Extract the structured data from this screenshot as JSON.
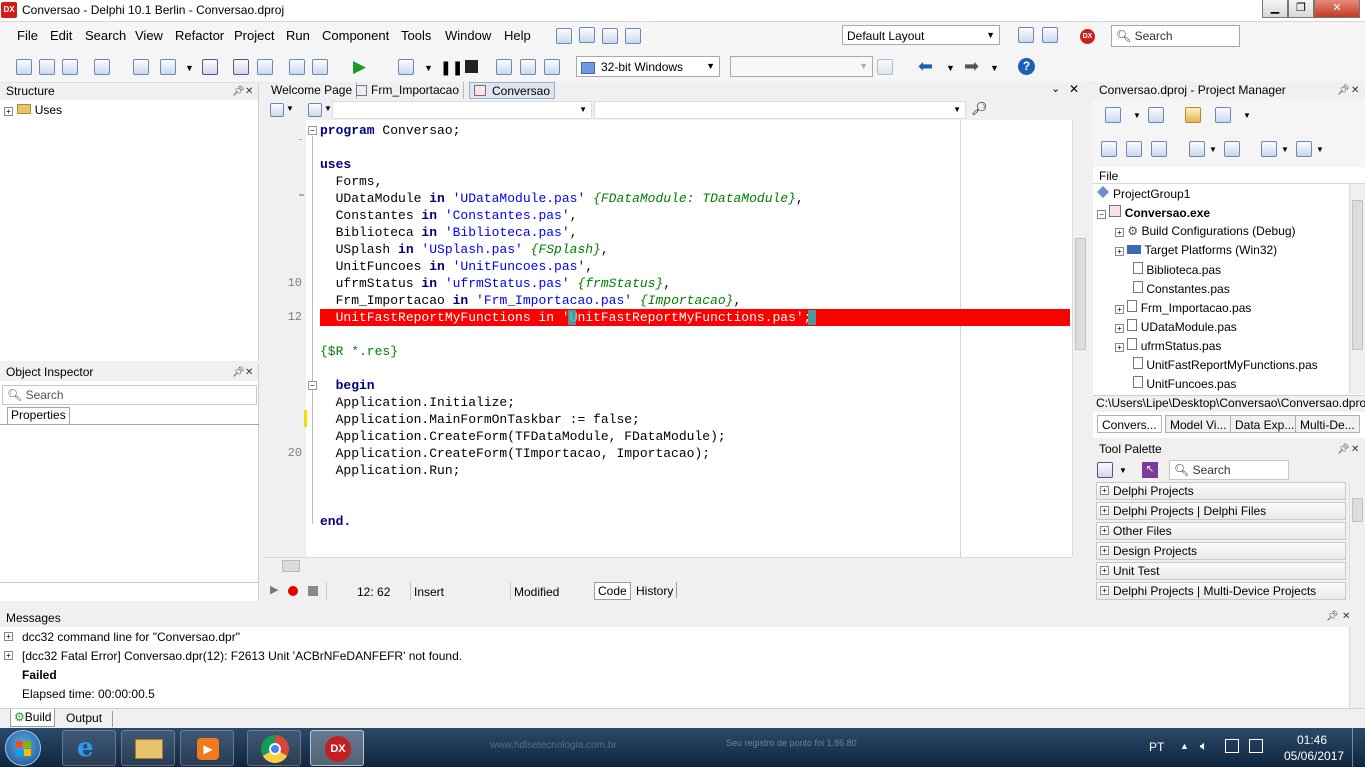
{
  "window": {
    "app_icon": "DX",
    "title": "Conversao - Delphi 10.1 Berlin - Conversao.dproj",
    "min_label": "▁",
    "max_label": "❐",
    "close_label": "✕"
  },
  "menu": [
    "File",
    "Edit",
    "Search",
    "View",
    "Refactor",
    "Project",
    "Run",
    "Component",
    "Tools",
    "Window",
    "Help"
  ],
  "toolbar": {
    "layout_combo": "Default Layout",
    "search_placeholder": "Search",
    "platform_combo": "32-bit Windows",
    "config_combo": ""
  },
  "structure": {
    "title": "Structure",
    "items": [
      "Uses"
    ]
  },
  "object_inspector": {
    "title": "Object Inspector",
    "search_placeholder": "Search",
    "tab": "Properties"
  },
  "editor": {
    "tabs": [
      "Welcome Page",
      "Frm_Importacao",
      "Conversao"
    ],
    "line_numbers": [
      "10",
      "12",
      "20"
    ],
    "code": {
      "l1_kw": "program",
      "l1_rest": " Conversao;",
      "l3_kw": "uses",
      "l4": "  Forms,",
      "l5_a": "  UDataModule ",
      "l5_in": "in",
      "l5_str": " 'UDataModule.pas'",
      "l5_cmt": " {FDataModule: TDataModule}",
      "l5_end": ",",
      "l6_a": "  Constantes ",
      "l6_in": "in",
      "l6_str": " 'Constantes.pas'",
      "l6_end": ",",
      "l7_a": "  Biblioteca ",
      "l7_in": "in",
      "l7_str": " 'Biblioteca.pas'",
      "l7_end": ",",
      "l8_a": "  USplash ",
      "l8_in": "in",
      "l8_str": " 'USplash.pas'",
      "l8_cmt": " {FSplash}",
      "l8_end": ",",
      "l9_a": "  UnitFuncoes ",
      "l9_in": "in",
      "l9_str": " 'UnitFuncoes.pas'",
      "l9_end": ",",
      "l10_a": "  ufrmStatus ",
      "l10_in": "in",
      "l10_str": " 'ufrmStatus.pas'",
      "l10_cmt": " {frmStatus}",
      "l10_end": ",",
      "l11_a": "  Frm_Importacao ",
      "l11_in": "in",
      "l11_str": " 'Frm_Importacao.pas'",
      "l11_cmt": " {Importacao}",
      "l11_end": ",",
      "l12": "  UnitFastReportMyFunctions in 'UnitFastReportMyFunctions.pas';",
      "l14": "{$R *.res}",
      "l16_kw": "  begin",
      "l17": "  Application.Initialize;",
      "l18": "  Application.MainFormOnTaskbar := false;",
      "l19": "  Application.CreateForm(TFDataModule, FDataModule);",
      "l20": "  Application.CreateForm(TImportacao, Importacao);",
      "l21": "  Application.Run;",
      "l24_kw": "end."
    },
    "status": {
      "position": "12: 62",
      "mode": "Insert",
      "state": "Modified",
      "tab_code": "Code",
      "tab_history": "History"
    }
  },
  "project_manager": {
    "title": "Conversao.dproj - Project Manager",
    "file_header": "File",
    "tree": [
      "ProjectGroup1",
      "Conversao.exe",
      "Build Configurations (Debug)",
      "Target Platforms (Win32)",
      "Biblioteca.pas",
      "Constantes.pas",
      "Frm_Importacao.pas",
      "UDataModule.pas",
      "ufrmStatus.pas",
      "UnitFastReportMyFunctions.pas",
      "UnitFuncoes.pas"
    ],
    "path": "C:\\Users\\Lipe\\Desktop\\Conversao\\Conversao.dproj",
    "tabs": [
      "Convers...",
      "Model Vi...",
      "Data Exp...",
      "Multi-De..."
    ]
  },
  "tool_palette": {
    "title": "Tool Palette",
    "search_placeholder": "Search",
    "categories": [
      "Delphi Projects",
      "Delphi Projects | Delphi Files",
      "Other Files",
      "Design Projects",
      "Unit Test",
      "Delphi Projects | Multi-Device Projects"
    ]
  },
  "messages": {
    "title": "Messages",
    "rows": [
      "dcc32 command line for \"Conversao.dpr\"",
      "[dcc32 Fatal Error] Conversao.dpr(12): F2613 Unit 'ACBrNFeDANFEFR' not found.",
      "Failed",
      "Elapsed time: 00:00:00.5"
    ],
    "tabs": [
      "Build",
      "Output"
    ]
  },
  "taskbar": {
    "lang": "PT",
    "time": "01:46",
    "date": "05/06/2017",
    "apps": [
      "windows-start",
      "internet-explorer",
      "file-explorer",
      "media-player",
      "chrome",
      "delphi"
    ],
    "background_text_1": "www.hdlsetecnologia.com.br",
    "background_text_2": "Seu registro de ponto foi 1.86.80"
  }
}
